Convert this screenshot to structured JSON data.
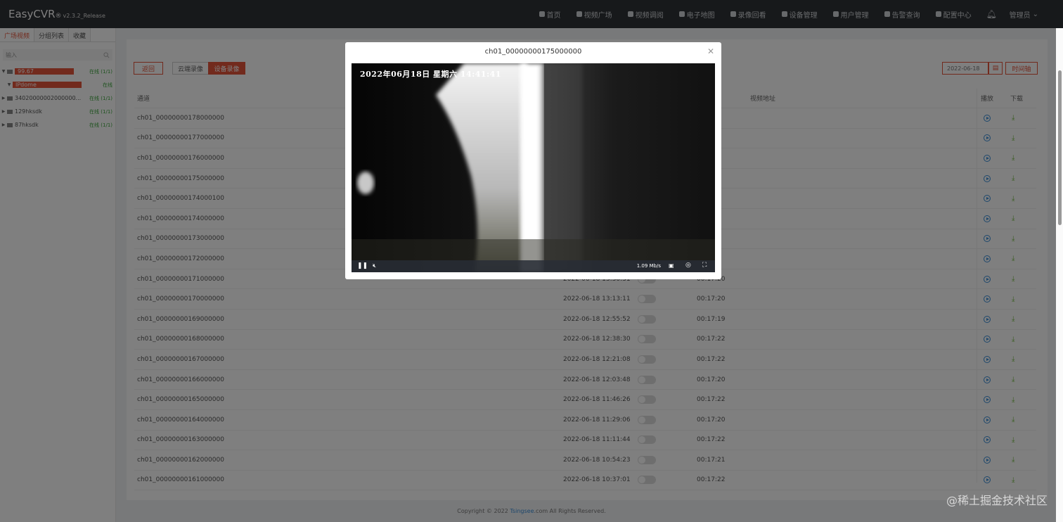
{
  "app": {
    "name": "EasyCVR",
    "registered": "®",
    "version": "v2.3.2_Release"
  },
  "nav": [
    {
      "label": "首页",
      "icon": "home-icon"
    },
    {
      "label": "视频广场",
      "icon": "video-square-icon"
    },
    {
      "label": "视频调阅",
      "icon": "grid-icon"
    },
    {
      "label": "电子地图",
      "icon": "map-pin-icon"
    },
    {
      "label": "录像回看",
      "icon": "camera-icon"
    },
    {
      "label": "设备管理",
      "icon": "device-icon"
    },
    {
      "label": "用户管理",
      "icon": "user-icon"
    },
    {
      "label": "告警查询",
      "icon": "alarm-icon"
    },
    {
      "label": "配置中心",
      "icon": "settings-icon"
    }
  ],
  "user": {
    "name": "管理员"
  },
  "sidebar": {
    "tabs": [
      "广场视频",
      "分组列表",
      "收藏"
    ],
    "search_placeholder": "输入",
    "tree": [
      {
        "name": "99.67",
        "status": "在线 (1/1)",
        "highlight": true,
        "expanded": true
      },
      {
        "name": "IPdome",
        "status": "在线",
        "highlight": true,
        "child": true
      },
      {
        "name": "34020000002000000...",
        "status": "在线 (1/1)"
      },
      {
        "name": "129hksdk",
        "status": "在线 (1/1)"
      },
      {
        "name": "87hksdk",
        "status": "在线 (1/1)"
      }
    ]
  },
  "toolbar": {
    "back_label": "返回",
    "cloud_label": "云端录像",
    "device_label": "设备录像",
    "date_value": "2022-06-18",
    "timeaxis_label": "时间轴"
  },
  "table": {
    "headers": {
      "channel": "通道",
      "address": "视频地址",
      "play": "播放",
      "download": "下载"
    },
    "rows": [
      {
        "name": "ch01_00000000178000000",
        "time": "",
        "dur": ""
      },
      {
        "name": "ch01_00000000177000000",
        "time": "",
        "dur": ""
      },
      {
        "name": "ch01_00000000176000000",
        "time": "",
        "dur": ""
      },
      {
        "name": "ch01_00000000175000000",
        "time": "",
        "dur": ""
      },
      {
        "name": "ch01_00000000174000100",
        "time": "",
        "dur": ""
      },
      {
        "name": "ch01_00000000174000000",
        "time": "",
        "dur": ""
      },
      {
        "name": "ch01_00000000173000000",
        "time": "",
        "dur": ""
      },
      {
        "name": "ch01_00000000172000000",
        "time": "",
        "dur": ""
      },
      {
        "name": "ch01_00000000171000000",
        "time": "2022-06-18 13:30:31",
        "dur": "00:17:20"
      },
      {
        "name": "ch01_00000000170000000",
        "time": "2022-06-18 13:13:11",
        "dur": "00:17:20"
      },
      {
        "name": "ch01_00000000169000000",
        "time": "2022-06-18 12:55:52",
        "dur": "00:17:19"
      },
      {
        "name": "ch01_00000000168000000",
        "time": "2022-06-18 12:38:30",
        "dur": "00:17:22"
      },
      {
        "name": "ch01_00000000167000000",
        "time": "2022-06-18 12:21:08",
        "dur": "00:17:22"
      },
      {
        "name": "ch01_00000000166000000",
        "time": "2022-06-18 12:03:48",
        "dur": "00:17:20"
      },
      {
        "name": "ch01_00000000165000000",
        "time": "2022-06-18 11:46:26",
        "dur": "00:17:22"
      },
      {
        "name": "ch01_00000000164000000",
        "time": "2022-06-18 11:29:06",
        "dur": "00:17:20"
      },
      {
        "name": "ch01_00000000163000000",
        "time": "2022-06-18 11:11:44",
        "dur": "00:17:22"
      },
      {
        "name": "ch01_00000000162000000",
        "time": "2022-06-18 10:54:23",
        "dur": "00:17:21"
      },
      {
        "name": "ch01_00000000161000000",
        "time": "2022-06-18 10:37:01",
        "dur": "00:17:22"
      }
    ]
  },
  "footer": {
    "prefix": "Copyright © 2022 ",
    "company": "Tsingsee",
    "suffix": ".com All Rights Reserved."
  },
  "watermark": "@稀土掘金技术社区",
  "dialog": {
    "title": "ch01_00000000175000000",
    "osd": "2022年06月18日  星期六  14:41:41",
    "bitrate": "1.09 Mb/s"
  },
  "colors": {
    "accent": "#e4553b",
    "header_bg": "#2f3236",
    "online": "#3aa53a",
    "play": "#3b8fd9",
    "download": "#6fb83c"
  }
}
